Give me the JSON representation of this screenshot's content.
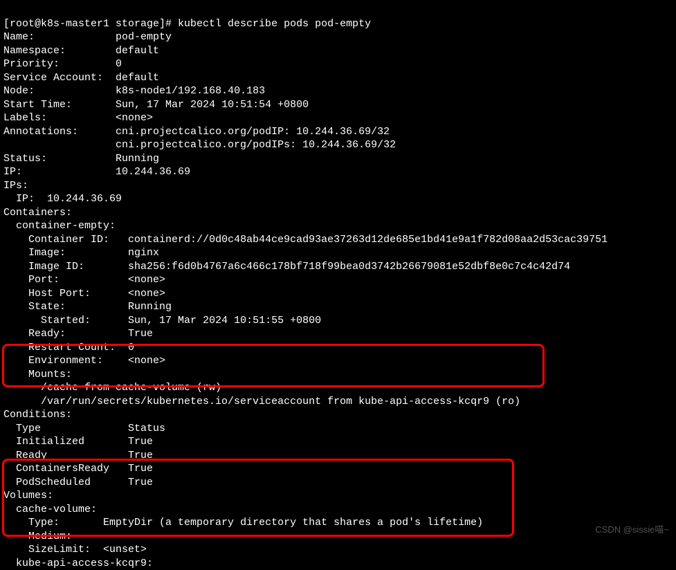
{
  "prompt": "[root@k8s-master1 storage]# kubectl describe pods pod-empty",
  "fields": {
    "name_label": "Name:",
    "name_value": "pod-empty",
    "namespace_label": "Namespace:",
    "namespace_value": "default",
    "priority_label": "Priority:",
    "priority_value": "0",
    "service_account_label": "Service Account:",
    "service_account_value": "default",
    "node_label": "Node:",
    "node_value": "k8s-node1/192.168.40.183",
    "start_time_label": "Start Time:",
    "start_time_value": "Sun, 17 Mar 2024 10:51:54 +0800",
    "labels_label": "Labels:",
    "labels_value": "<none>",
    "annotations_label": "Annotations:",
    "annotations_value1": "cni.projectcalico.org/podIP: 10.244.36.69/32",
    "annotations_value2": "cni.projectcalico.org/podIPs: 10.244.36.69/32",
    "status_label": "Status:",
    "status_value": "Running",
    "ip_label": "IP:",
    "ip_value": "10.244.36.69",
    "ips_label": "IPs:",
    "ips_entry": "  IP:  10.244.36.69",
    "containers_label": "Containers:",
    "container_name": "  container-empty:",
    "container_id_label": "    Container ID:",
    "container_id_value": "containerd://0d0c48ab44ce9cad93ae37263d12de685e1bd41e9a1f782d08aa2d53cac39751",
    "image_label": "    Image:",
    "image_value": "nginx",
    "image_id_label": "    Image ID:",
    "image_id_value": "sha256:f6d0b4767a6c466c178bf718f99bea0d3742b26679081e52dbf8e0c7c4c42d74",
    "port_label": "    Port:",
    "port_value": "<none>",
    "host_port_label": "    Host Port:",
    "host_port_value": "<none>",
    "state_label": "    State:",
    "state_value": "Running",
    "started_label": "      Started:",
    "started_value": "Sun, 17 Mar 2024 10:51:55 +0800",
    "ready_label": "    Ready:",
    "ready_value": "True",
    "restart_count_label": "    Restart Count:",
    "restart_count_value": "0",
    "environment_label": "    Environment:",
    "environment_value": "<none>",
    "mounts_label": "    Mounts:",
    "mount1": "      /cache from cache-volume (rw)",
    "mount2": "      /var/run/secrets/kubernetes.io/serviceaccount from kube-api-access-kcqr9 (ro)",
    "conditions_label": "Conditions:",
    "conditions_header": "  Type              Status",
    "cond_initialized": "  Initialized       True",
    "cond_ready": "  Ready             True",
    "cond_containers_ready": "  ContainersReady   True",
    "cond_pod_scheduled": "  PodScheduled      True",
    "volumes_label": "Volumes:",
    "volume_name": "  cache-volume:",
    "vol_type_label": "    Type:",
    "vol_type_value": "EmptyDir (a temporary directory that shares a pod's lifetime)",
    "vol_medium_label": "    Medium:",
    "vol_medium_value": "",
    "vol_sizelimit_label": "    SizeLimit:",
    "vol_sizelimit_value": "<unset>",
    "kube_api_access": "  kube-api-access-kcqr9:"
  },
  "watermark": "CSDN @sissie喵~"
}
